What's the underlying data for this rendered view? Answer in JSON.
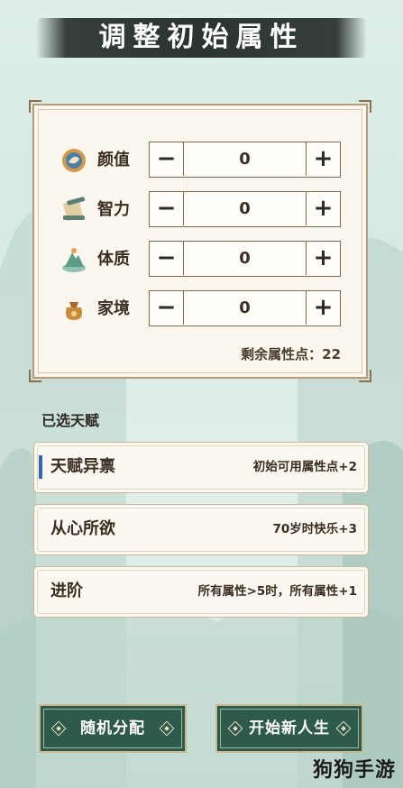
{
  "title": "调整初始属性",
  "attributes": [
    {
      "label": "颜值",
      "value": "0",
      "icon": "face-charm-icon"
    },
    {
      "label": "智力",
      "value": "0",
      "icon": "scroll-icon"
    },
    {
      "label": "体质",
      "value": "0",
      "icon": "mountain-icon"
    },
    {
      "label": "家境",
      "value": "0",
      "icon": "money-bag-icon"
    }
  ],
  "stepper": {
    "minus": "−",
    "plus": "+"
  },
  "remaining_points": "剩余属性点：22",
  "talents_title": "已选天赋",
  "talents": [
    {
      "name": "天赋异禀",
      "desc": "初始可用属性点+2",
      "selected": true
    },
    {
      "name": "从心所欲",
      "desc": "70岁时快乐+3",
      "selected": false
    },
    {
      "name": "进阶",
      "desc": "所有属性>5时，所有属性+1",
      "selected": false
    }
  ],
  "buttons": {
    "random": "随机分配",
    "start": "开始新人生"
  },
  "watermark": "狗狗手游",
  "colors": {
    "button_bg": "#2e5a4b",
    "selected_mark": "#2f66b8",
    "panel_bg": "#fbf7ee",
    "title_brush": "#2c3430"
  }
}
